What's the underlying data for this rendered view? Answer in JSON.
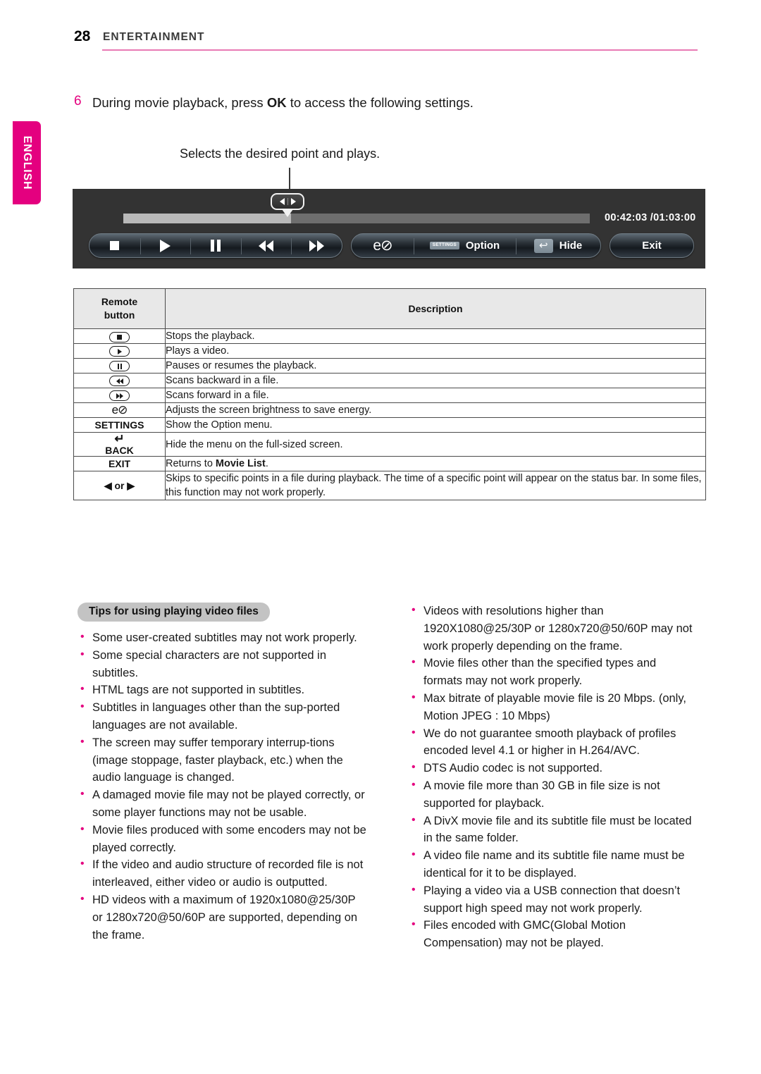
{
  "header": {
    "page_number": "28",
    "section_title": "ENTERTAINMENT",
    "rule_color": "#e87ab4"
  },
  "language_tab": {
    "label": "ENGLISH",
    "color": "#e4007f"
  },
  "step": {
    "number": "6",
    "text_before": "During movie playback, press ",
    "bold": "OK",
    "text_after": " to access the following settings."
  },
  "callout": {
    "label": "Selects the desired point and plays."
  },
  "player": {
    "time_current": "00:42:03",
    "time_separator": " /",
    "time_total": "01:03:00",
    "time_display": "00:42:03 /01:03:00",
    "progress_percent": 36,
    "transport_buttons": [
      {
        "name": "stop",
        "icon": "stop-icon"
      },
      {
        "name": "play",
        "icon": "play-icon"
      },
      {
        "name": "pause",
        "icon": "pause-icon"
      },
      {
        "name": "rewind",
        "icon": "rewind-icon"
      },
      {
        "name": "fast-forward",
        "icon": "fast-forward-icon"
      }
    ],
    "eco_glyph": "e⊘",
    "settings_chip_label": "SETTINGS",
    "option_label": "Option",
    "back_chip_glyph": "↩",
    "hide_label": "Hide",
    "exit_label": "Exit",
    "scrubber_icon": "left-right-scrub-icon"
  },
  "table": {
    "headers": {
      "col1_line1": "Remote",
      "col1_line2": "button",
      "col2": "Description"
    },
    "rows": [
      {
        "key_icon": "stop-key-icon",
        "key_label": "",
        "desc": "Stops the playback."
      },
      {
        "key_icon": "play-key-icon",
        "key_label": "",
        "desc": "Plays a video."
      },
      {
        "key_icon": "pause-key-icon",
        "key_label": "",
        "desc": "Pauses or resumes the playback."
      },
      {
        "key_icon": "rewind-key-icon",
        "key_label": "",
        "desc": "Scans backward in a file."
      },
      {
        "key_icon": "forward-key-icon",
        "key_label": "",
        "desc": "Scans forward in a file."
      },
      {
        "key_icon": "energy-saving-key-icon",
        "key_label": "e⊘",
        "desc": "Adjusts the screen brightness to save energy."
      },
      {
        "key_icon": "settings-key-icon",
        "key_label": "SETTINGS",
        "desc": "Show the Option menu."
      },
      {
        "key_icon": "back-key-icon",
        "key_label": "BACK",
        "desc": "Hide the menu on the full-sized screen."
      },
      {
        "key_icon": "exit-key-icon",
        "key_label": "EXIT",
        "desc_before": "Returns to ",
        "desc_bold": "Movie List",
        "desc_after": "."
      },
      {
        "key_icon": "left-right-key-icon",
        "key_label": "◀ or ▶",
        "desc": "Skips to specific points in a file during playback. The time of a specific point will appear on the status bar. In some files, this function may not work properly."
      }
    ]
  },
  "tips": {
    "heading": "Tips for using playing video files",
    "bullet_color": "#e4007f",
    "left_column": [
      "Some user-created subtitles may not work properly.",
      "Some special characters are not supported in subtitles.",
      "HTML tags are not supported in subtitles.",
      "Subtitles in languages other than the sup-ported languages are not available.",
      "The screen may suffer temporary interrup-tions (image stoppage, faster playback, etc.) when the audio language is changed.",
      "A damaged movie file may not be played correctly, or some player functions may not be usable.",
      "Movie files produced with some encoders may not be played correctly.",
      "If the video and audio structure of recorded file is not interleaved, either video or audio is outputted.",
      "HD videos with a maximum of 1920x1080@25/30P or 1280x720@50/60P are supported, depending on the frame."
    ],
    "right_column": [
      "Videos with resolutions higher than 1920X1080@25/30P or 1280x720@50/60P may not work properly depending on the frame.",
      "Movie files other than the specified types and formats may not work properly.",
      "Max bitrate of playable movie file is 20 Mbps. (only, Motion JPEG : 10 Mbps)",
      "We do not guarantee smooth playback of profiles encoded level 4.1 or higher in H.264/AVC.",
      "DTS Audio codec is not supported.",
      "A movie file more than 30 GB in file size is not supported for playback.",
      "A DivX movie file and its subtitle file must be located in the same folder.",
      "A video file name and its subtitle file name must be identical for it to be displayed.",
      "Playing a video via a USB connection that doesn’t support high speed may not work properly.",
      "Files encoded with GMC(Global Motion Compensation) may not be played."
    ]
  }
}
